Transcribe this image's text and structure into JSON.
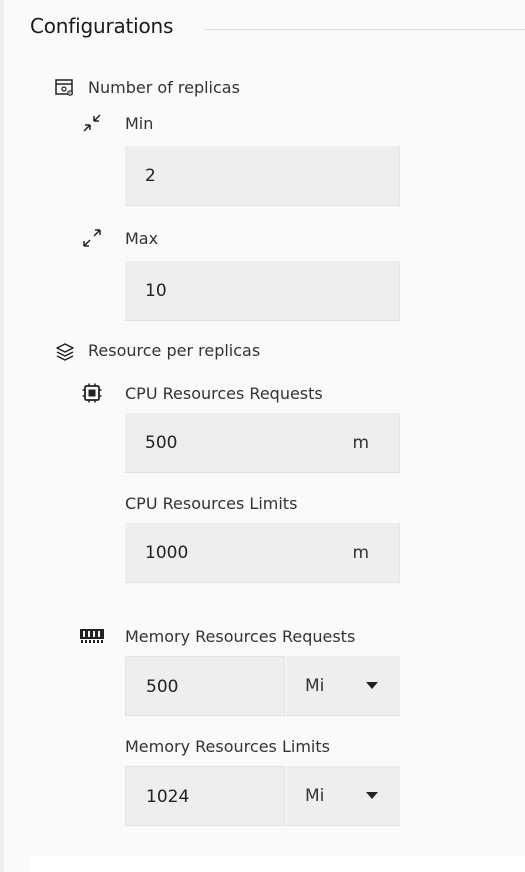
{
  "section": {
    "title": "Configurations"
  },
  "replicas": {
    "label": "Number of replicas",
    "icon": "replica-settings-icon",
    "min": {
      "label": "Min",
      "icon": "collapse-arrows-icon",
      "value": "2"
    },
    "max": {
      "label": "Max",
      "icon": "expand-arrows-icon",
      "value": "10"
    }
  },
  "resources": {
    "label": "Resource per replicas",
    "icon": "layers-icon",
    "cpu": {
      "icon": "cpu-chip-icon",
      "requests": {
        "label": "CPU Resources Requests",
        "value": "500",
        "unit": "m"
      },
      "limits": {
        "label": "CPU Resources Limits",
        "value": "1000",
        "unit": "m"
      }
    },
    "memory": {
      "icon": "memory-module-icon",
      "requests": {
        "label": "Memory Resources Requests",
        "value": "500",
        "unit": "Mi"
      },
      "limits": {
        "label": "Memory Resources Limits",
        "value": "1024",
        "unit": "Mi"
      }
    }
  }
}
